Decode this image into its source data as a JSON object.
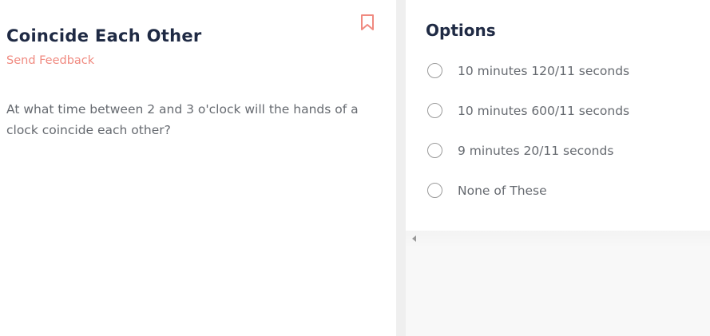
{
  "question": {
    "title": "Coincide Each Other",
    "feedback_label": "Send Feedback",
    "text": "At what time between 2 and 3 o'clock will the hands of a clock coincide each other?",
    "bookmark_icon": "bookmark-icon"
  },
  "options_panel": {
    "title": "Options",
    "items": [
      {
        "label": "10 minutes 120/11 seconds"
      },
      {
        "label": "10 minutes 600/11 seconds"
      },
      {
        "label": "9 minutes 20/11 seconds"
      },
      {
        "label": "None of These"
      }
    ]
  },
  "colors": {
    "accent": "#f08a80",
    "heading": "#1f2a44",
    "body_text": "#666a70"
  }
}
